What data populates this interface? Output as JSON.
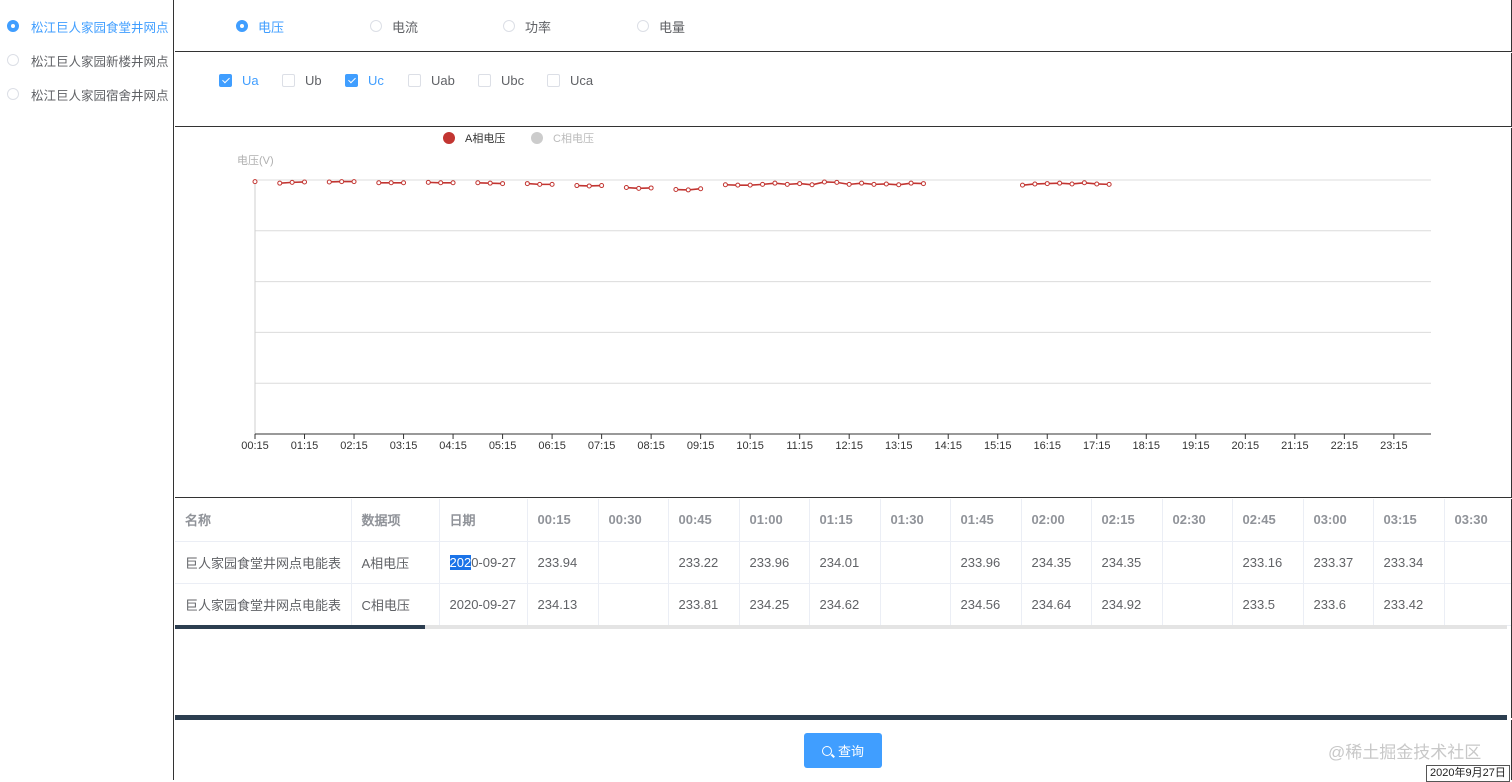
{
  "sidebar": {
    "items": [
      {
        "label": "松江巨人家园食堂井网点",
        "selected": true
      },
      {
        "label": "松江巨人家园新楼井网点",
        "selected": false
      },
      {
        "label": "松江巨人家园宿舍井网点",
        "selected": false
      }
    ]
  },
  "type_options": [
    {
      "label": "电压",
      "selected": true
    },
    {
      "label": "电流",
      "selected": false
    },
    {
      "label": "功率",
      "selected": false
    },
    {
      "label": "电量",
      "selected": false
    }
  ],
  "metric_options": [
    {
      "label": "Ua",
      "checked": true
    },
    {
      "label": "Ub",
      "checked": false
    },
    {
      "label": "Uc",
      "checked": true
    },
    {
      "label": "Uab",
      "checked": false
    },
    {
      "label": "Ubc",
      "checked": false
    },
    {
      "label": "Uca",
      "checked": false
    }
  ],
  "colors": {
    "accent": "#409eff",
    "series_a": "#c23531",
    "series_c_legend": "#cccccc"
  },
  "chart_data": {
    "type": "line",
    "ylabel": "电压(V)",
    "legend_position": "top",
    "grid": true,
    "x_tick_labels": [
      "00:15",
      "01:15",
      "02:15",
      "03:15",
      "04:15",
      "05:15",
      "06:15",
      "07:15",
      "08:15",
      "09:15",
      "10:15",
      "11:15",
      "12:15",
      "13:15",
      "14:15",
      "15:15",
      "16:15",
      "17:15",
      "18:15",
      "19:15",
      "20:15",
      "21:15",
      "22:15",
      "23:15"
    ],
    "series": [
      {
        "name": "A相电压",
        "visible": true,
        "points": [
          [
            0.0,
            234.1
          ],
          [
            0.5,
            233.9
          ],
          [
            0.75,
            234.0
          ],
          [
            1.0,
            234.05
          ],
          [
            1.5,
            234.05
          ],
          [
            1.75,
            234.1
          ],
          [
            2.0,
            234.1
          ],
          [
            2.5,
            233.95
          ],
          [
            2.75,
            233.95
          ],
          [
            3.0,
            233.95
          ],
          [
            3.5,
            234.0
          ],
          [
            3.75,
            233.95
          ],
          [
            4.0,
            233.95
          ],
          [
            4.5,
            233.95
          ],
          [
            4.75,
            233.9
          ],
          [
            5.0,
            233.85
          ],
          [
            5.5,
            233.85
          ],
          [
            5.75,
            233.75
          ],
          [
            6.0,
            233.75
          ],
          [
            6.5,
            233.6
          ],
          [
            6.75,
            233.55
          ],
          [
            7.0,
            233.6
          ],
          [
            7.5,
            233.35
          ],
          [
            7.75,
            233.25
          ],
          [
            8.0,
            233.3
          ],
          [
            8.5,
            233.1
          ],
          [
            8.75,
            233.05
          ],
          [
            9.0,
            233.2
          ],
          [
            9.5,
            233.7
          ],
          [
            9.75,
            233.65
          ],
          [
            10.0,
            233.65
          ],
          [
            10.25,
            233.75
          ],
          [
            10.5,
            233.9
          ],
          [
            10.75,
            233.75
          ],
          [
            11.0,
            233.85
          ],
          [
            11.25,
            233.7
          ],
          [
            11.5,
            234.05
          ],
          [
            11.75,
            234.0
          ],
          [
            12.0,
            233.75
          ],
          [
            12.25,
            233.9
          ],
          [
            12.5,
            233.75
          ],
          [
            12.75,
            233.8
          ],
          [
            13.0,
            233.7
          ],
          [
            13.25,
            233.9
          ],
          [
            13.5,
            233.85
          ],
          [
            15.5,
            233.65
          ],
          [
            15.75,
            233.8
          ],
          [
            16.0,
            233.85
          ],
          [
            16.25,
            233.9
          ],
          [
            16.5,
            233.8
          ],
          [
            16.75,
            233.95
          ],
          [
            17.0,
            233.8
          ],
          [
            17.25,
            233.75
          ]
        ]
      },
      {
        "name": "C相电压",
        "visible": false
      }
    ]
  },
  "table": {
    "columns": [
      "名称",
      "数据项",
      "日期",
      "00:15",
      "00:30",
      "00:45",
      "01:00",
      "01:15",
      "01:30",
      "01:45",
      "02:00",
      "02:15",
      "02:30",
      "02:45",
      "03:00",
      "03:15",
      "03:30"
    ],
    "rows": [
      [
        "巨人家园食堂井网点电能表",
        "A相电压",
        "2020-09-27",
        "233.94",
        "",
        "233.22",
        "233.96",
        "234.01",
        "",
        "233.96",
        "234.35",
        "234.35",
        "",
        "233.16",
        "233.37",
        "233.34",
        ""
      ],
      [
        "巨人家园食堂井网点电能表",
        "C相电压",
        "2020-09-27",
        "234.13",
        "",
        "233.81",
        "234.25",
        "234.62",
        "",
        "234.56",
        "234.64",
        "234.92",
        "",
        "233.5",
        "233.6",
        "233.42",
        ""
      ]
    ],
    "selected_text": "202"
  },
  "query_button": {
    "label": "查询"
  },
  "watermark": "@稀土掘金技术社区",
  "date_tooltip": "2020年9月27日"
}
